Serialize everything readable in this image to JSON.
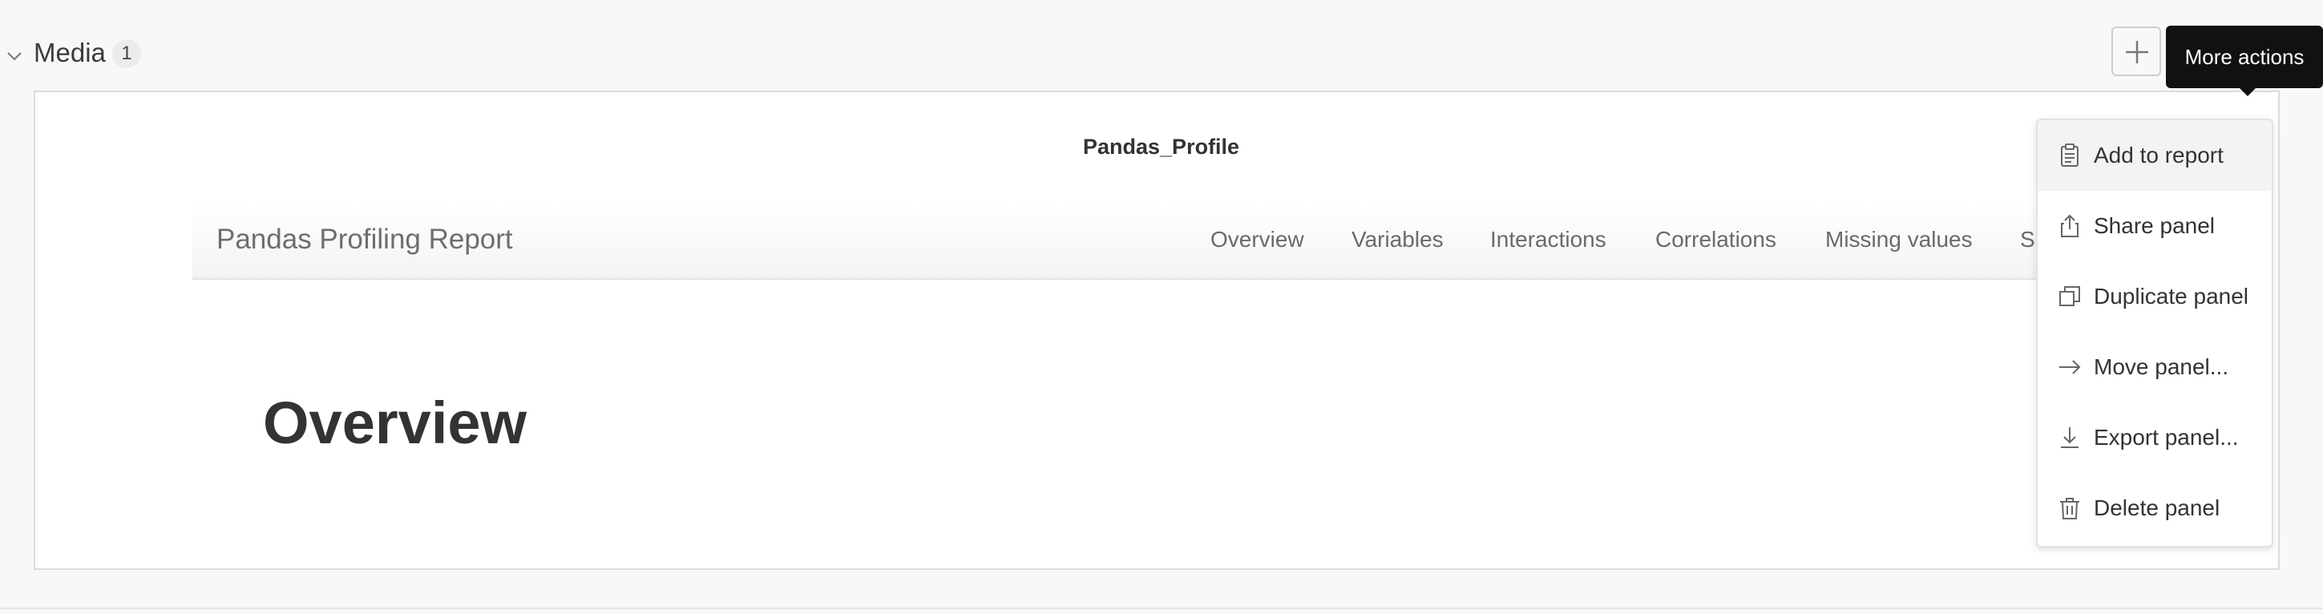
{
  "section": {
    "title": "Media",
    "count": "1"
  },
  "toolbar": {
    "tooltip": "More actions"
  },
  "panel": {
    "title": "Pandas_Profile",
    "report_brand": "Pandas Profiling Report",
    "nav": [
      "Overview",
      "Variables",
      "Interactions",
      "Correlations",
      "Missing values",
      "S"
    ],
    "heading": "Overview"
  },
  "menu": {
    "items": [
      {
        "label": "Add to report",
        "icon": "clipboard-icon"
      },
      {
        "label": "Share panel",
        "icon": "share-icon"
      },
      {
        "label": "Duplicate panel",
        "icon": "duplicate-icon"
      },
      {
        "label": "Move panel...",
        "icon": "arrow-right-icon"
      },
      {
        "label": "Export panel...",
        "icon": "download-icon"
      },
      {
        "label": "Delete panel",
        "icon": "trash-icon"
      }
    ]
  }
}
